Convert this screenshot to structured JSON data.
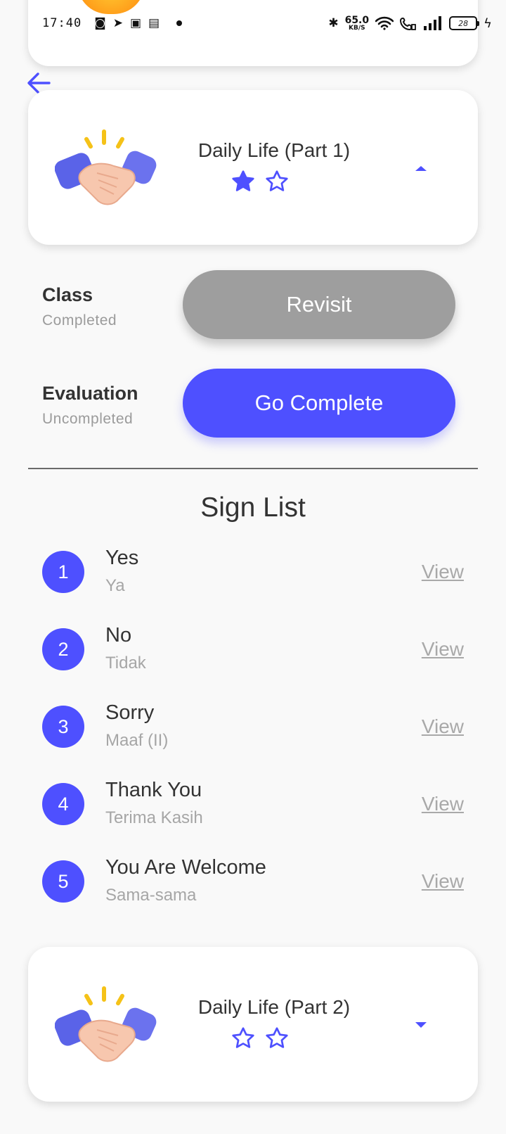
{
  "status_bar": {
    "time": "17:40",
    "net_speed_value": "65.0",
    "net_speed_unit": "KB/S",
    "battery": "28"
  },
  "colors": {
    "accent": "#4e50ff",
    "muted_button": "#9e9e9e",
    "text": "#333333",
    "subtext": "#9b9b9b"
  },
  "icons": {
    "back": "arrow-left-icon",
    "handshake": "handshake-icon",
    "star_filled": "star-filled-icon",
    "star_outline": "star-outline-icon",
    "caret_up": "caret-up-icon",
    "caret_down": "caret-down-icon"
  },
  "lessons": [
    {
      "title": "Daily Life (Part 1)",
      "stars_earned": 1,
      "stars_total": 2,
      "expanded": true
    },
    {
      "title": "Daily Life (Part 2)",
      "stars_earned": 0,
      "stars_total": 2,
      "expanded": false
    }
  ],
  "progress": {
    "class": {
      "label": "Class",
      "status": "Completed",
      "button": "Revisit"
    },
    "evaluation": {
      "label": "Evaluation",
      "status": "Uncompleted",
      "button": "Go Complete"
    }
  },
  "sign_list": {
    "title": "Sign List",
    "view_label": "View",
    "items": [
      {
        "number": "1",
        "english": "Yes",
        "indonesian": "Ya"
      },
      {
        "number": "2",
        "english": "No",
        "indonesian": "Tidak"
      },
      {
        "number": "3",
        "english": "Sorry",
        "indonesian": "Maaf (II)"
      },
      {
        "number": "4",
        "english": "Thank You",
        "indonesian": "Terima Kasih"
      },
      {
        "number": "5",
        "english": "You Are Welcome",
        "indonesian": "Sama-sama"
      }
    ]
  }
}
